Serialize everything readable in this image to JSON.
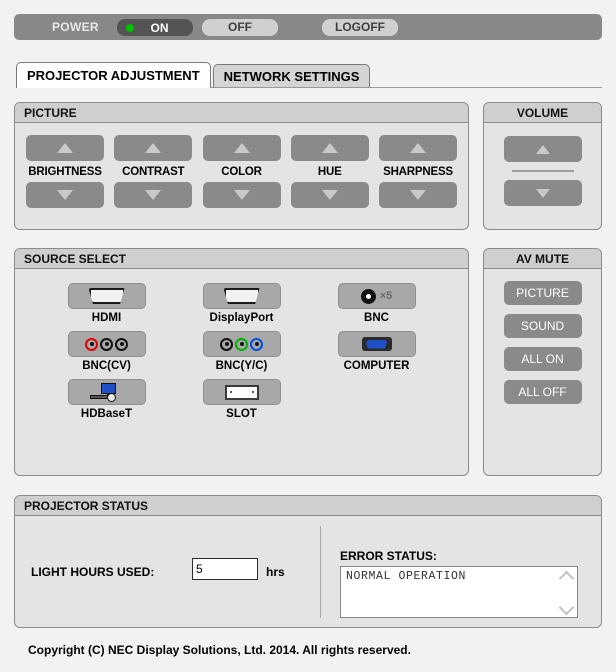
{
  "power_bar": {
    "label": "POWER",
    "on_label": "ON",
    "off_label": "OFF",
    "logoff_label": "LOGOFF",
    "led_color": "#00c000",
    "on_active": true
  },
  "tabs": [
    {
      "label": "PROJECTOR ADJUSTMENT",
      "active": true
    },
    {
      "label": "NETWORK SETTINGS",
      "active": false
    }
  ],
  "picture": {
    "title": "PICTURE",
    "controls": [
      {
        "label": "BRIGHTNESS",
        "up_icon": "triangle-up-icon",
        "down_icon": "triangle-down-icon"
      },
      {
        "label": "CONTRAST",
        "up_icon": "triangle-up-icon",
        "down_icon": "triangle-down-icon"
      },
      {
        "label": "COLOR",
        "up_icon": "triangle-up-icon",
        "down_icon": "triangle-down-icon"
      },
      {
        "label": "HUE",
        "up_icon": "triangle-up-icon",
        "down_icon": "triangle-down-icon"
      },
      {
        "label": "SHARPNESS",
        "up_icon": "triangle-up-icon",
        "down_icon": "triangle-down-icon"
      }
    ]
  },
  "volume": {
    "title": "VOLUME",
    "up_icon": "triangle-up-icon",
    "down_icon": "triangle-down-icon"
  },
  "source_select": {
    "title": "SOURCE SELECT",
    "items": [
      {
        "label": "HDMI",
        "icon": "hdmi-port-icon"
      },
      {
        "label": "DisplayPort",
        "icon": "displayport-port-icon"
      },
      {
        "label": "BNC",
        "icon": "bnc-connector-icon",
        "suffix": "×5"
      },
      {
        "label": "BNC(CV)",
        "icon": "bnc-cv-triple-connector-icon",
        "colors": [
          "#e00000",
          "#111111",
          "#111111"
        ]
      },
      {
        "label": "BNC(Y/C)",
        "icon": "bnc-yc-triple-connector-icon",
        "colors": [
          "#111111",
          "#00b000",
          "#0050e0"
        ]
      },
      {
        "label": "COMPUTER",
        "icon": "vga-connector-icon"
      },
      {
        "label": "HDBaseT",
        "icon": "hdbaset-icon"
      },
      {
        "label": "SLOT",
        "icon": "slot-card-icon"
      }
    ]
  },
  "av_mute": {
    "title": "AV MUTE",
    "buttons": [
      "PICTURE",
      "SOUND",
      "ALL ON",
      "ALL OFF"
    ]
  },
  "projector_status": {
    "title": "PROJECTOR STATUS",
    "light_hours_label": "LIGHT HOURS USED:",
    "light_hours_value": "5",
    "light_hours_unit": "hrs",
    "error_status_label": "ERROR STATUS:",
    "error_status_text": "NORMAL OPERATION"
  },
  "footer": {
    "copyright": "Copyright (C) NEC Display Solutions, Ltd. 2014. All rights reserved."
  }
}
